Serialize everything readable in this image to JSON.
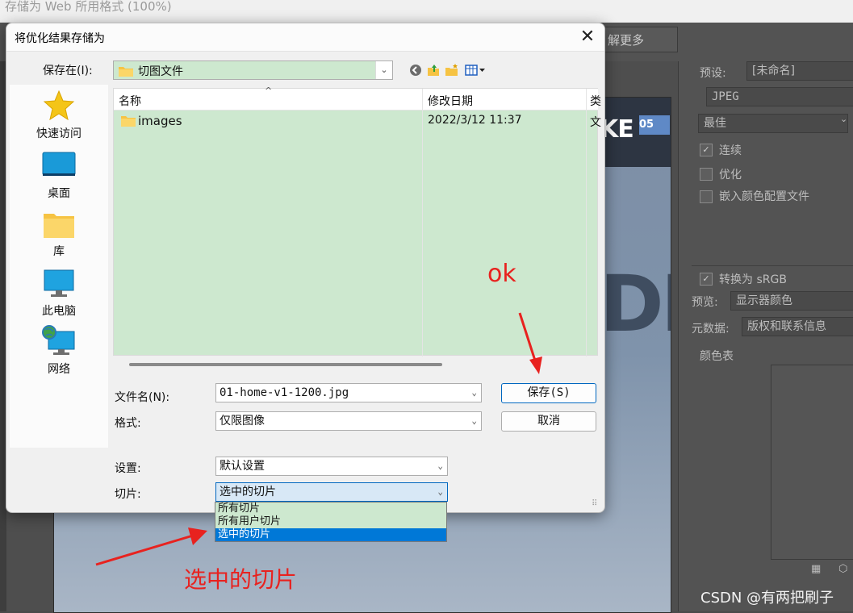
{
  "ps": {
    "window_title": "存储为 Web 所用格式 (100%)",
    "learn_more": "解更多",
    "panel": {
      "preset_label": "预设:",
      "preset_value": "[未命名]",
      "format_value": "JPEG",
      "quality_value": "最佳",
      "progressive_label": "连续",
      "optimized_label": "优化",
      "embed_profile_label": "嵌入颜色配置文件",
      "convert_srgb_label": "转换为 sRGB",
      "preview_label": "预览:",
      "preview_value": "显示器颜色",
      "metadata_label": "元数据:",
      "metadata_value": "版权和联系信息",
      "color_table_label": "颜色表"
    },
    "image_text_ke": "KE",
    "image_text_de": "DE",
    "slice_badge": "05"
  },
  "dialog": {
    "title": "将优化结果存储为",
    "close": "✕",
    "save_in_label": "保存在(I):",
    "save_in_value": "切图文件",
    "places": [
      {
        "label": "快速访问",
        "icon": "star-icon"
      },
      {
        "label": "桌面",
        "icon": "desktop-icon"
      },
      {
        "label": "库",
        "icon": "library-folder-icon"
      },
      {
        "label": "此电脑",
        "icon": "computer-icon"
      },
      {
        "label": "网络",
        "icon": "network-icon"
      }
    ],
    "columns": {
      "name": "名称",
      "date": "修改日期",
      "type": "类"
    },
    "files": [
      {
        "name": "images",
        "date": "2022/3/12 11:37",
        "type": "文"
      }
    ],
    "filename_label": "文件名(N):",
    "filename_value": "01-home-v1-1200.jpg",
    "format_label": "格式:",
    "format_value": "仅限图像",
    "settings_label": "设置:",
    "settings_value": "默认设置",
    "slices_label": "切片:",
    "slices_value": "选中的切片",
    "save_button": "保存(S)",
    "cancel_button": "取消",
    "slice_options": [
      "所有切片",
      "所有用户切片",
      "选中的切片"
    ],
    "selected_option_index": 2
  },
  "annotations": {
    "ok_text": "ok",
    "selected_slice_text": "选中的切片",
    "color": "#e8221f"
  },
  "watermark": "CSDN @有两把刷子"
}
